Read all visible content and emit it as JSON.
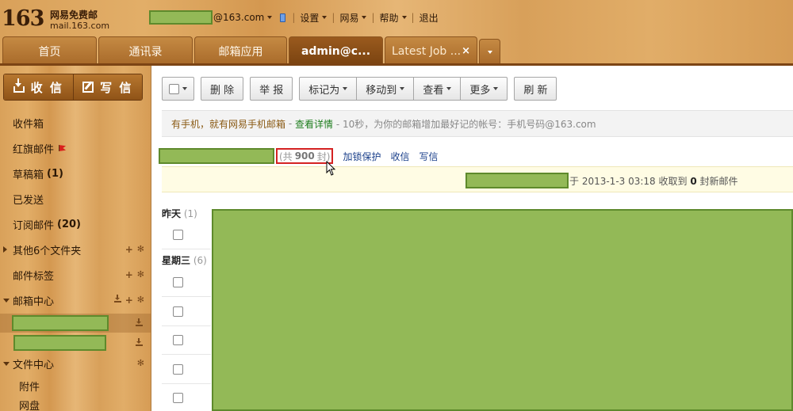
{
  "logo": {
    "number": "163",
    "name_cn": "网易免费邮",
    "domain": "mail.163.com"
  },
  "topbar": {
    "user_domain": "@163.com",
    "items": [
      {
        "label": "设置"
      },
      {
        "label": "网易"
      },
      {
        "label": "帮助"
      }
    ],
    "logout": "退出",
    "separator": "|"
  },
  "tabs": [
    {
      "label": "首页"
    },
    {
      "label": "通讯录"
    },
    {
      "label": "邮箱应用"
    },
    {
      "label": "admin@c..."
    },
    {
      "label": "Latest Job ..."
    }
  ],
  "tab_close": "×",
  "sidebar": {
    "receive": "收 信",
    "write": "写 信",
    "folders": [
      {
        "label": "收件箱",
        "count": ""
      },
      {
        "label": "红旗邮件",
        "count": ""
      },
      {
        "label": "草稿箱",
        "count": "(1)"
      },
      {
        "label": "已发送",
        "count": ""
      },
      {
        "label": "订阅邮件",
        "count": "(20)"
      },
      {
        "label": "其他6个文件夹",
        "count": ""
      },
      {
        "label": "邮件标签",
        "count": ""
      },
      {
        "label": "邮箱中心",
        "count": ""
      },
      {
        "label": "文件中心",
        "count": ""
      },
      {
        "label": "附件",
        "count": ""
      },
      {
        "label": "网盘",
        "count": ""
      }
    ],
    "plus": "+",
    "gear": "✻"
  },
  "toolbar": {
    "delete": "删 除",
    "report": "举 报",
    "mark_as": "标记为",
    "move_to": "移动到",
    "view": "查看",
    "more": "更多",
    "refresh": "刷 新"
  },
  "promo": {
    "text": "有手机，就有网易手机邮箱",
    "dash": " - ",
    "link": "查看详情",
    "tail": " - 10秒，为你的邮箱增加最好记的帐号：手机号码@163.com"
  },
  "mailbox_info": {
    "count_prefix": "(共",
    "count": "900",
    "count_suffix": "封)",
    "lock": "加锁保护",
    "receive": "收信",
    "write": "写信"
  },
  "notice": {
    "prefix": "于 2013-1-3 03:18 收取到",
    "count": "0",
    "suffix": "封新邮件"
  },
  "groups": [
    {
      "label": "昨天",
      "count": "(1)"
    },
    {
      "label": "星期三",
      "count": "(6)"
    }
  ]
}
